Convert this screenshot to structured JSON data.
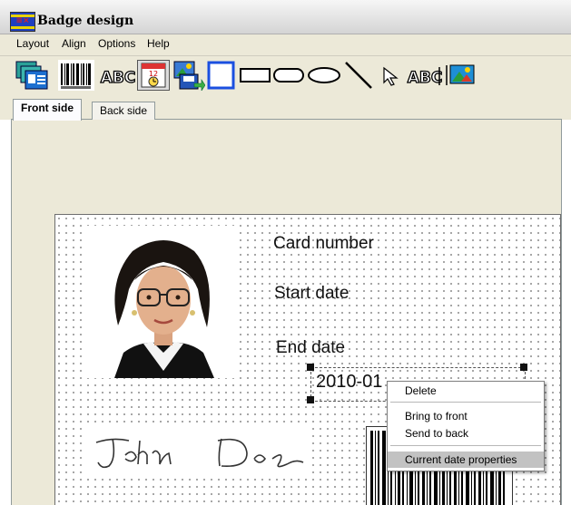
{
  "window": {
    "title": "Badge design"
  },
  "menu": {
    "items": [
      "Layout",
      "Align",
      "Options",
      "Help"
    ]
  },
  "toolbar": {
    "tools": [
      "templates-icon",
      "barcode-icon",
      "text-icon",
      "date-field-icon",
      "image-import-icon",
      "square-icon",
      "rectangle-icon",
      "rounded-rectangle-icon",
      "ellipse-icon",
      "line-icon",
      "pointer-icon",
      "text-field-icon",
      "picture-icon"
    ],
    "text_tool_label": "ABC",
    "text_field_label": "ABC"
  },
  "tabs": [
    {
      "label": "Front side",
      "active": true
    },
    {
      "label": "Back side",
      "active": false
    }
  ],
  "card": {
    "card_number_label": "Card number",
    "start_date_label": "Start date",
    "end_date_label": "End date",
    "date_value": "2010-01-08",
    "date_value_visible": "2010-01",
    "signature_text": "John Doe"
  },
  "context_menu": {
    "items": [
      "Delete",
      "Bring to front",
      "Send to back",
      "Current date properties"
    ],
    "highlighted": "Current date properties"
  }
}
